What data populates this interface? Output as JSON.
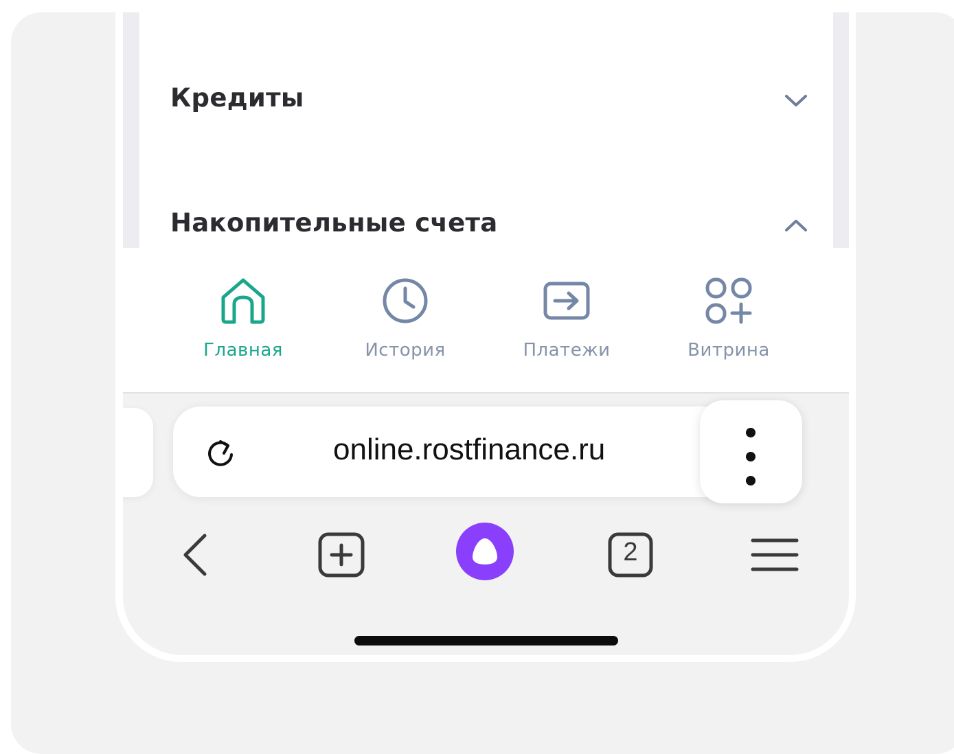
{
  "sections": [
    {
      "title": "Кредиты",
      "expanded": false,
      "chevron_icon": "chevron-down-icon"
    },
    {
      "title": "Накопительные счета",
      "expanded": true,
      "chevron_icon": "chevron-up-icon"
    }
  ],
  "tabbar": {
    "active_color": "#1aa68a",
    "inactive_color": "#8693a8",
    "items": [
      {
        "label": "Главная",
        "icon": "home-icon",
        "active": true
      },
      {
        "label": "История",
        "icon": "clock-icon",
        "active": false
      },
      {
        "label": "Платежи",
        "icon": "arrow-right-box-icon",
        "active": false
      },
      {
        "label": "Витрина",
        "icon": "grid-plus-icon",
        "active": false
      }
    ]
  },
  "browser": {
    "url": "online.rostfinance.ru",
    "reload_icon": "reload-icon",
    "menu_icon": "more-vertical-icon",
    "tab_count": "2",
    "assistant_color": "#8a3ffc",
    "nav": [
      "back-icon",
      "new-tab-icon",
      "alice-icon",
      "tabs-count-icon",
      "hamburger-menu-icon"
    ]
  }
}
